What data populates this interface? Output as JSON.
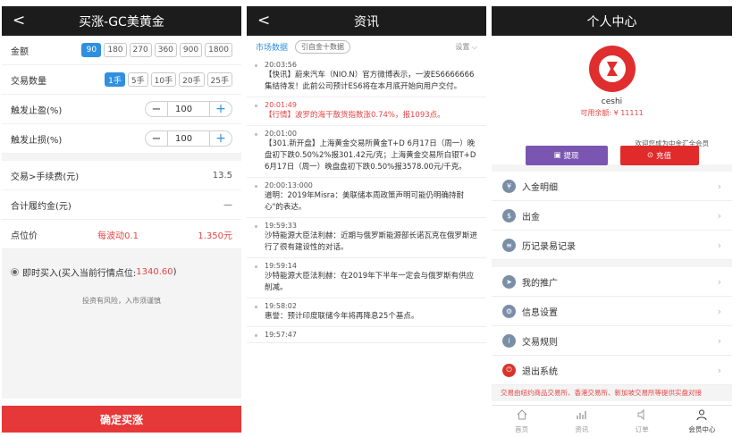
{
  "trade": {
    "title": "买涨-GC美黄金",
    "back_label": "<",
    "amount_label": "金额",
    "amount_options": [
      "90",
      "180",
      "270",
      "360",
      "900",
      "1800"
    ],
    "amount_selected_index": 0,
    "qty_label": "交易数量",
    "qty_options": [
      "1手",
      "5手",
      "10手",
      "20手",
      "25手"
    ],
    "qty_selected_index": 0,
    "stop_profit_label": "触发止盈(%)",
    "stop_profit_value": "100",
    "stop_loss_label": "触发止损(%)",
    "stop_loss_value": "100",
    "minus": "−",
    "plus": "+",
    "fee_label": "交易>手续费(元)",
    "fee_value": "13.5",
    "margin_label": "合计履约金(元)",
    "margin_value": "—",
    "point_label": "点位价",
    "point_value": "每波动0.1",
    "point_value_right": "1.350元",
    "buy_now_label": "即时买入(买入当前行情点位:",
    "buy_now_value": "1340.60",
    "buy_now_close": ")",
    "risk_text": "投资有风险，入市须谨慎",
    "confirm_label": "确定买涨"
  },
  "news": {
    "title": "资讯",
    "back_label": "<",
    "tab_market": "市场数据",
    "tab_pill": "引自金十数据",
    "tab_settings": "设置 ⌵",
    "items": [
      {
        "time": "20:03:56",
        "content": "【快讯】蔚来汽车（NIO.N）官方微博表示，一波ES6666666集结待发！此前公司预计ES6将在本月底开始向用户交付。",
        "highlight": false
      },
      {
        "time": "20:01:49",
        "content": "【行情】波罗的海干散货指数涨0.74%，报1093点。",
        "highlight": true
      },
      {
        "time": "20:01:00",
        "content": "【301.新开盘】上海黄金交易所黄金T+D 6月17日（周一）晚盘初下跌0.50%2%报301.42元/克；上海黄金交易所白银T+D 6月17日（周一）晚盘盘初下跌0.50%报3578.00元/千克。",
        "highlight": false
      },
      {
        "time": "20:00:13:000",
        "content": "道明：2019年Misra：美联储本周政策声明可能仍明确持耐心\"的表达。",
        "highlight": false
      },
      {
        "time": "19:59:33",
        "content": "沙特能源大臣法利赫：近期与俄罗斯能源部长诺瓦克在俄罗斯进行了很有建设性的对话。",
        "highlight": false
      },
      {
        "time": "19:59:14",
        "content": "沙特能源大臣法利赫：在2019年下半年一定会与俄罗斯有供应削减。",
        "highlight": false
      },
      {
        "time": "19:58:02",
        "content": "惠誉：预计印度联储今年将再降息25个基点。",
        "highlight": false
      },
      {
        "time": "19:57:47",
        "content": "",
        "highlight": false
      }
    ]
  },
  "profile": {
    "title": "个人中心",
    "username": "ceshi",
    "balance_label": "可用余额:",
    "balance_value": "¥ 11111",
    "welcome": "欢迎您成为中金汇全会员",
    "withdraw_label": "提现",
    "deposit_label": "充值",
    "menu_group1": [
      {
        "label": "入金明细",
        "icon": "deposit-detail-icon"
      },
      {
        "label": "出金",
        "icon": "withdraw-icon"
      },
      {
        "label": "历记录易记录",
        "icon": "record-icon"
      }
    ],
    "menu_group2": [
      {
        "label": "我的推广",
        "icon": "promotion-icon"
      },
      {
        "label": "信息设置",
        "icon": "info-settings-icon"
      },
      {
        "label": "交易规则",
        "icon": "rules-icon"
      },
      {
        "label": "退出系统",
        "icon": "logout-icon"
      }
    ],
    "notice": "交易由纽约商品交易所、香港交易所、新加坡交易所等提供实盘对接",
    "nav": [
      {
        "label": "首页",
        "icon": "home-icon"
      },
      {
        "label": "资讯",
        "icon": "chart-icon"
      },
      {
        "label": "订单",
        "icon": "order-icon"
      },
      {
        "label": "会员中心",
        "icon": "member-icon"
      }
    ],
    "nav_active_index": 3
  }
}
